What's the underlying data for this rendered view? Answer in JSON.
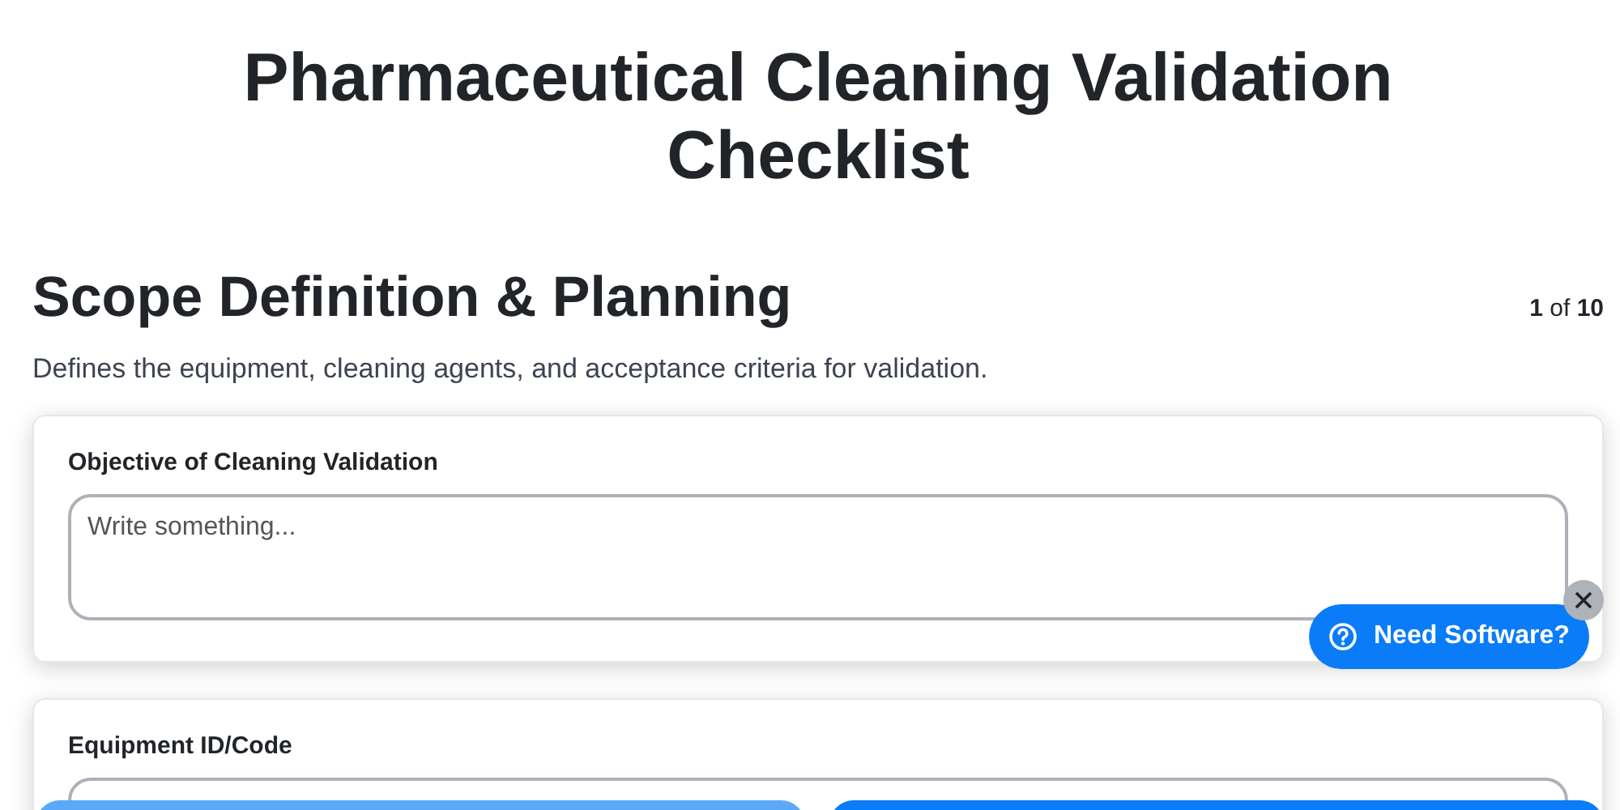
{
  "title": "Pharmaceutical Cleaning Validation Checklist",
  "section": {
    "heading": "Scope Definition & Planning",
    "progress": "**1** of **10**",
    "description": "Defines the equipment, cleaning agents, and acceptance criteria for validation."
  },
  "fields": [
    {
      "label": "Objective of Cleaning Validation",
      "kind": "textarea",
      "placeholder": "Write something..."
    },
    {
      "label": "Equipment ID/Code",
      "kind": "input"
    }
  ],
  "help_button": {
    "label": "Need Software?"
  },
  "bottom_buttons": [
    {
      "kind": "secondary"
    },
    {
      "kind": "primary"
    }
  ]
}
